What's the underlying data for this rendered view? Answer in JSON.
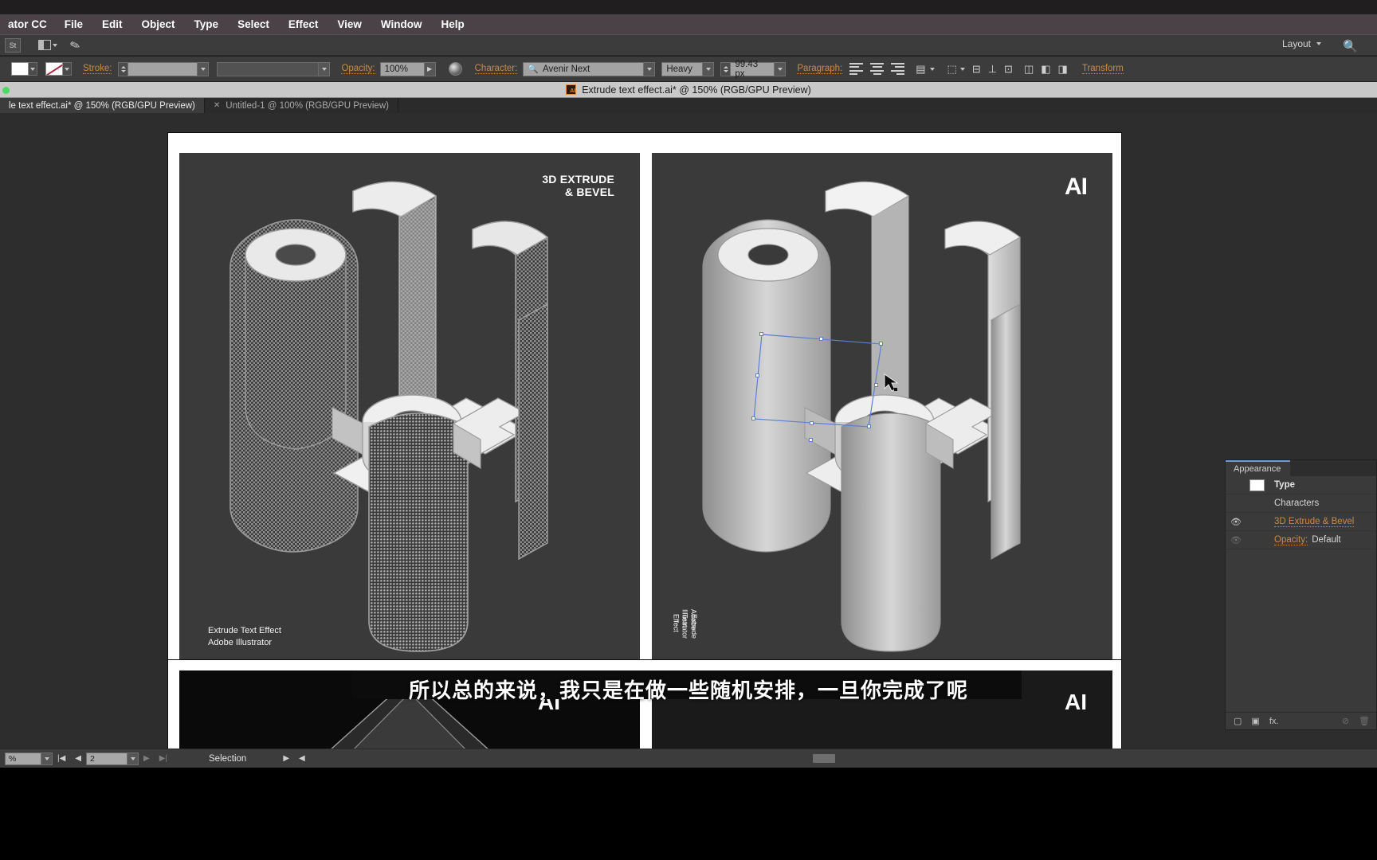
{
  "app": {
    "name": "ator CC"
  },
  "menu": {
    "items": [
      "File",
      "Edit",
      "Object",
      "Type",
      "Select",
      "Effect",
      "View",
      "Window",
      "Help"
    ]
  },
  "control_row1": {
    "layout_label": "Layout",
    "tool_icon": "St",
    "arrange_icon": "arrange-documents-icon",
    "feather_icon": "feather-icon",
    "search_icon": "search-icon"
  },
  "control_row2": {
    "fill_swatch": "#ffffff",
    "stroke_swatch": "#ffffff",
    "stroke_label": "Stroke:",
    "stroke_weight": "",
    "stroke_profile": "",
    "opacity_label": "Opacity:",
    "opacity_value": "100%",
    "character_label": "Character:",
    "font_family": "Avenir Next",
    "font_style": "Heavy",
    "font_size": "99.43 px",
    "paragraph_label": "Paragraph:",
    "transform_label": "Transform"
  },
  "document_title": "Extrude text effect.ai* @ 150% (RGB/GPU Preview)",
  "tabs": [
    {
      "label": "le text effect.ai* @ 150% (RGB/GPU Preview)",
      "active": true,
      "closable": false
    },
    {
      "label": "Untitled-1 @ 100% (RGB/GPU Preview)",
      "active": false,
      "closable": true
    }
  ],
  "artboards": {
    "left": {
      "title_line1": "3D EXTRUDE",
      "title_line2": "& BEVEL",
      "caption_line1": "Extrude Text Effect",
      "caption_line2": "Adobe Illustrator"
    },
    "right": {
      "badge": "AI",
      "caption_line1": "Extrude Text Effect",
      "caption_line2": "Adobe Illustrator"
    },
    "bottom_left": {
      "badge": "AI"
    },
    "bottom_right": {
      "badge": "AI"
    }
  },
  "subtitle": "所以总的来说，我只是在做一些随机安排，一旦你完成了呢",
  "appearance_panel": {
    "tab_label": "Appearance",
    "rows": [
      {
        "eye": false,
        "swatch": true,
        "label": "Type",
        "kind": "bold"
      },
      {
        "eye": false,
        "swatch": false,
        "label": "Characters",
        "kind": "plain"
      },
      {
        "eye": true,
        "swatch": false,
        "label": "3D Extrude & Bevel",
        "kind": "link"
      },
      {
        "eye": "dim",
        "swatch": false,
        "label_prefix": "Opacity:",
        "label_value": "Default",
        "kind": "mix"
      }
    ],
    "footer_icons": [
      "new-art-icon",
      "duplicate-icon",
      "fx-icon",
      "clear-appearance-icon",
      "delete-icon"
    ]
  },
  "status_bar": {
    "zoom_value": "%",
    "artboard_number": "2",
    "tool_status": "Selection"
  },
  "colors": {
    "menu_bg": "#4a4246",
    "panel_bg": "#3a3a3a",
    "canvas_bg": "#2d2d2d",
    "artboard_bg": "#3a3a3a",
    "accent_link": "#c68b49",
    "selection_blue": "#5b7fd4",
    "tab_accent": "#6a9bd4"
  }
}
